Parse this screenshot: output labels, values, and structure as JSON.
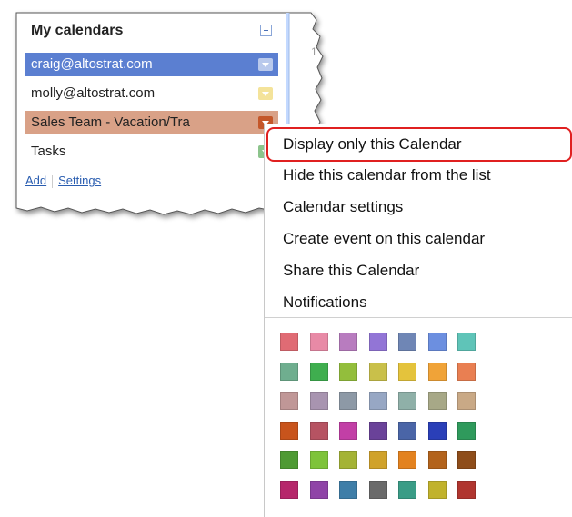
{
  "panel": {
    "title": "My calendars",
    "calendars": [
      {
        "label": "craig@altostrat.com",
        "row_bg": "#5b7fd1",
        "text_color": "#ffffff",
        "swatch": "#b9c9ec"
      },
      {
        "label": "molly@altostrat.com",
        "row_bg": "#ffffff",
        "text_color": "#222222",
        "swatch": "#f4e39a"
      },
      {
        "label": "Sales Team - Vacation/Tra",
        "row_bg": "#d9a187",
        "text_color": "#222222",
        "swatch": "#c4572a"
      },
      {
        "label": "Tasks",
        "row_bg": "#ffffff",
        "text_color": "#222222",
        "swatch": "#8cc48c"
      }
    ],
    "add_link": "Add",
    "settings_link": "Settings",
    "edge_digit": "1"
  },
  "menu": {
    "items": [
      "Display only this Calendar",
      "Hide this calendar from the list",
      "Calendar settings",
      "Create event on this calendar",
      "Share this Calendar",
      "Notifications"
    ],
    "highlight_color": "#e02020",
    "palette": [
      [
        "#e06b74",
        "#e88aa6",
        "#b87cbf",
        "#9275d6",
        "#6f86b5",
        "#6c8fe0",
        "#5fc4b8"
      ],
      [
        "#6fae8f",
        "#3fae4f",
        "#93be3c",
        "#c9c04a",
        "#e4c33c",
        "#f0a338",
        "#e97f52"
      ],
      [
        "#c09797",
        "#a894b0",
        "#8d99a6",
        "#97a7c4",
        "#8fb0a8",
        "#a7a887",
        "#c9a986"
      ],
      [
        "#c8541c",
        "#b65362",
        "#c23fa6",
        "#6a4299",
        "#4a65a7",
        "#2a3fb8",
        "#2f9a5c"
      ],
      [
        "#4e9a33",
        "#7ec33a",
        "#a4b335",
        "#d0a22a",
        "#e3821f",
        "#b3631c",
        "#8e4d1a"
      ],
      [
        "#b6276b",
        "#8f44a7",
        "#3f7ea8",
        "#6a6a6a",
        "#3a9c86",
        "#c1b22c",
        "#b0352f"
      ]
    ]
  }
}
